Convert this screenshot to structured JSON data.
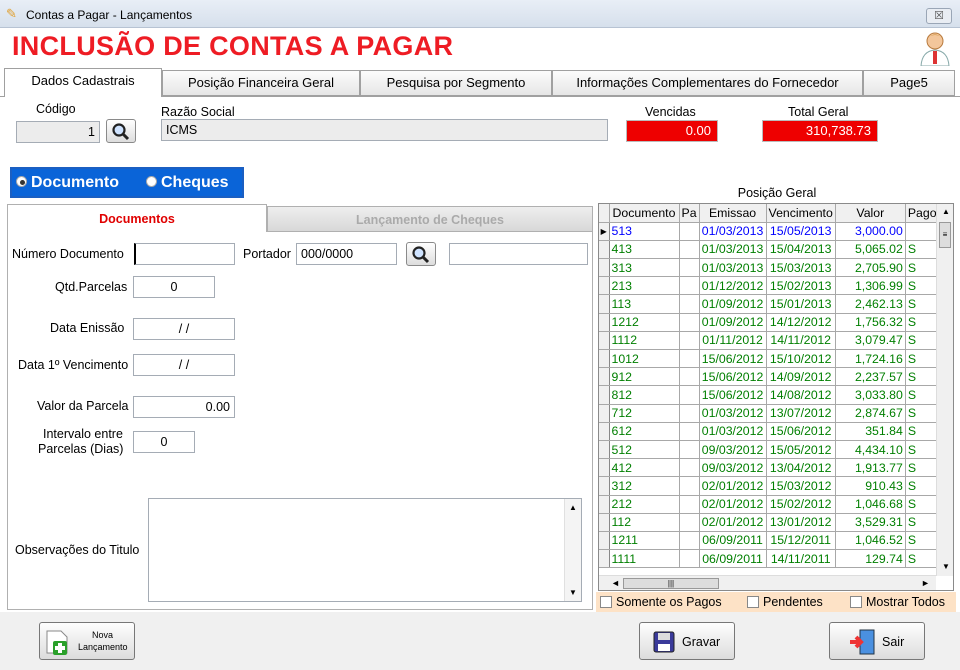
{
  "window": {
    "title": "Contas a Pagar - Lançamentos",
    "close": "☒"
  },
  "header": {
    "title": "INCLUSÃO DE CONTAS A PAGAR"
  },
  "tabs": [
    "Dados Cadastrais",
    "Posição Financeira Geral",
    "Pesquisa por Segmento",
    "Informações Complementares do Fornecedor",
    "Page5"
  ],
  "top": {
    "codigo_label": "Código",
    "codigo_value": "1",
    "razao_label": "Razão Social",
    "razao_value": "ICMS",
    "vencidas_label": "Vencidas",
    "vencidas_value": "0.00",
    "total_label": "Total Geral",
    "total_value": "310,738.73"
  },
  "mode": {
    "documento": "Documento",
    "cheques": "Cheques"
  },
  "subtabs": {
    "documentos": "Documentos",
    "cheques": "Lançamento de Cheques"
  },
  "form": {
    "numero_label": "Número Documento",
    "numero_value": "",
    "portador_label": "Portador",
    "portador_value": "000/0000",
    "portador_desc": "",
    "qtd_label": "Qtd.Parcelas",
    "qtd_value": "0",
    "emissao_label": "Data Enissão",
    "emissao_value": "/ /",
    "venc_label": "Data 1º Vencimento",
    "venc_value": "/ /",
    "valor_label": "Valor da Parcela",
    "valor_value": "0.00",
    "intervalo_label1": "Intervalo entre",
    "intervalo_label2": "Parcelas (Dias)",
    "intervalo_value": "0",
    "obs_label": "Observações do Titulo"
  },
  "grid": {
    "title": "Posição Geral",
    "columns": [
      "Documento",
      "Pa",
      "Emissao",
      "Vencimento",
      "Valor",
      "Pago"
    ],
    "rows": [
      [
        "513",
        "",
        "01/03/2013",
        "15/05/2013",
        "3,000.00",
        ""
      ],
      [
        "413",
        "",
        "01/03/2013",
        "15/04/2013",
        "5,065.02",
        "S"
      ],
      [
        "313",
        "",
        "01/03/2013",
        "15/03/2013",
        "2,705.90",
        "S"
      ],
      [
        "213",
        "",
        "01/12/2012",
        "15/02/2013",
        "1,306.99",
        "S"
      ],
      [
        "113",
        "",
        "01/09/2012",
        "15/01/2013",
        "2,462.13",
        "S"
      ],
      [
        "1212",
        "",
        "01/09/2012",
        "14/12/2012",
        "1,756.32",
        "S"
      ],
      [
        "1112",
        "",
        "01/11/2012",
        "14/11/2012",
        "3,079.47",
        "S"
      ],
      [
        "1012",
        "",
        "15/06/2012",
        "15/10/2012",
        "1,724.16",
        "S"
      ],
      [
        "912",
        "",
        "15/06/2012",
        "14/09/2012",
        "2,237.57",
        "S"
      ],
      [
        "812",
        "",
        "15/06/2012",
        "14/08/2012",
        "3,033.80",
        "S"
      ],
      [
        "712",
        "",
        "01/03/2012",
        "13/07/2012",
        "2,874.67",
        "S"
      ],
      [
        "612",
        "",
        "01/03/2012",
        "15/06/2012",
        "351.84",
        "S"
      ],
      [
        "512",
        "",
        "09/03/2012",
        "15/05/2012",
        "4,434.10",
        "S"
      ],
      [
        "412",
        "",
        "09/03/2012",
        "13/04/2012",
        "1,913.77",
        "S"
      ],
      [
        "312",
        "",
        "02/01/2012",
        "15/03/2012",
        "910.43",
        "S"
      ],
      [
        "212",
        "",
        "02/01/2012",
        "15/02/2012",
        "1,046.68",
        "S"
      ],
      [
        "112",
        "",
        "02/01/2012",
        "13/01/2012",
        "3,529.31",
        "S"
      ],
      [
        "1211",
        "",
        "06/09/2011",
        "15/12/2011",
        "1,046.52",
        "S"
      ],
      [
        "1111",
        "",
        "06/09/2011",
        "14/11/2011",
        "129.74",
        "S"
      ]
    ]
  },
  "checks": {
    "pagos": "Somente os Pagos",
    "pendentes": "Pendentes",
    "todos": "Mostrar Todos"
  },
  "buttons": {
    "novo1": "Nova",
    "novo2": "Lançamento",
    "gravar": "Gravar",
    "sair": "Sair"
  },
  "colors": {
    "accent": "#ee1c24",
    "mode_bar": "#0a64d8",
    "row_blue": "#0000ff",
    "row_green": "#007f00"
  }
}
